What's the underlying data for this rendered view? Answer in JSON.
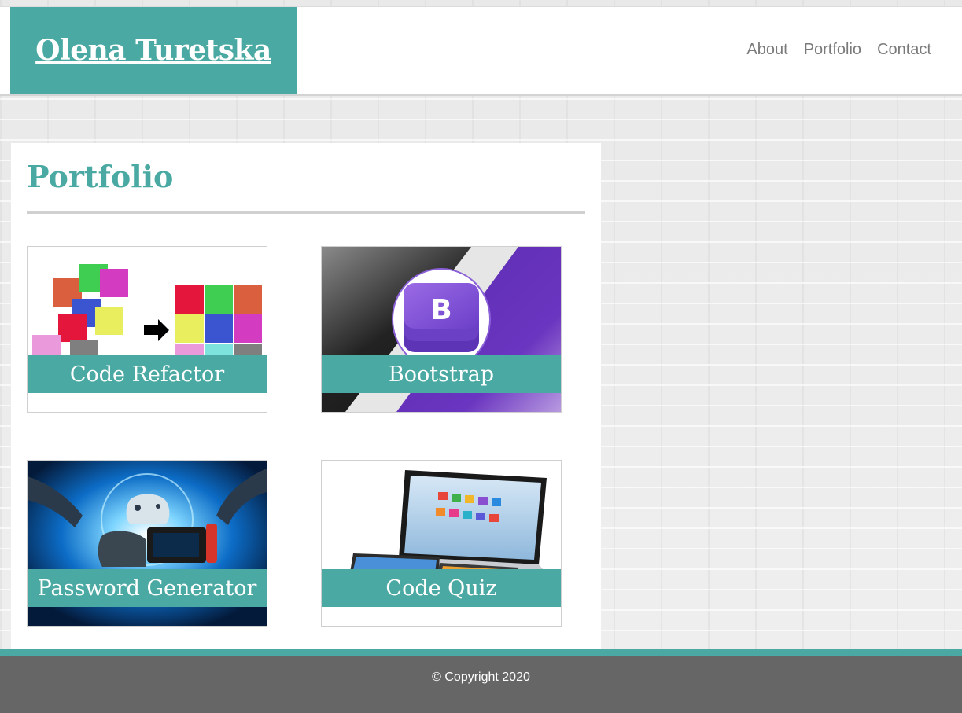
{
  "header": {
    "brand": "Olena Turetska",
    "nav": [
      "About",
      "Portfolio",
      "Contact"
    ]
  },
  "main": {
    "title": "Portfolio",
    "projects": [
      {
        "label": "Code Refactor",
        "image": "colored-squares-refactor-image"
      },
      {
        "label": "Bootstrap",
        "image": "bootstrap-logo-image"
      },
      {
        "label": "Password Generator",
        "image": "game-controllers-energy-image"
      },
      {
        "label": "Code Quiz",
        "image": "laptop-devices-image"
      }
    ]
  },
  "footer": {
    "copyright": "© Copyright 2020"
  },
  "colors": {
    "accent": "#4aa9a2",
    "footer": "#666666",
    "nav_text": "#7a7a7a"
  }
}
